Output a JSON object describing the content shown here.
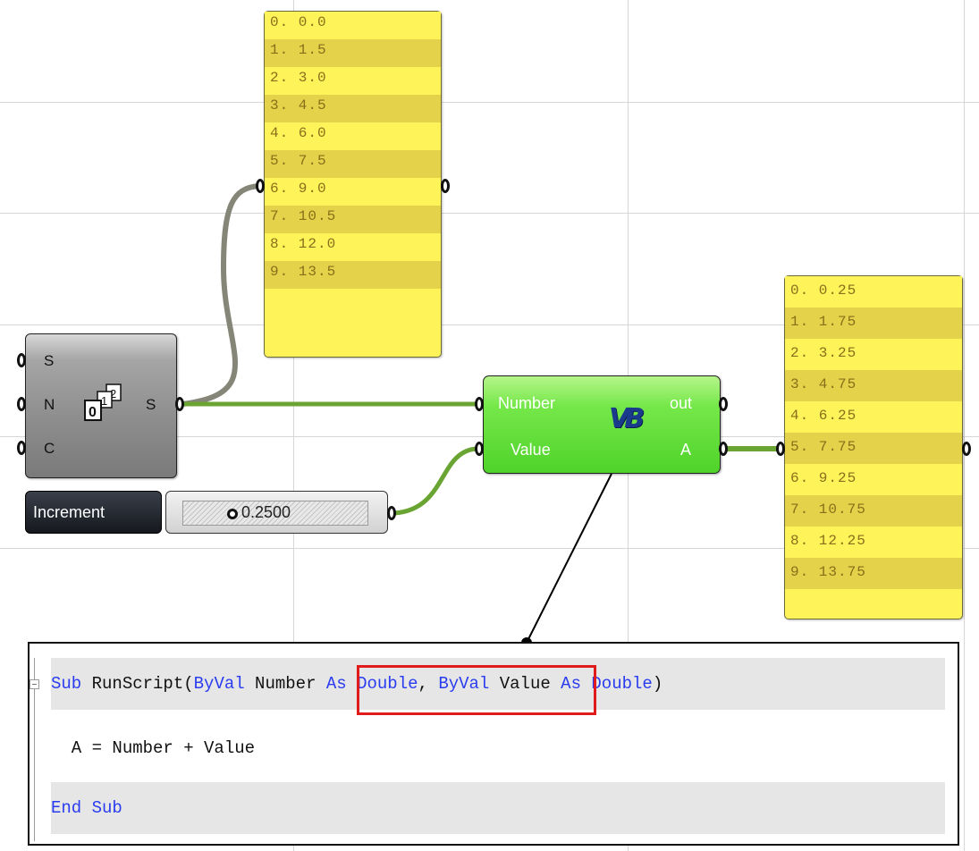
{
  "series_component": {
    "inputs": [
      "S",
      "N",
      "C"
    ],
    "output": "S",
    "icon": "series-icon"
  },
  "vb_component": {
    "inputs": [
      "Number",
      "Value"
    ],
    "outputs": [
      "out",
      "A"
    ],
    "icon": "vb-script-icon",
    "icon_text": "VB"
  },
  "slider": {
    "name": "Increment",
    "value": "0.2500"
  },
  "panel_series": [
    "0. 0.0",
    "1. 1.5",
    "2. 3.0",
    "3. 4.5",
    "4. 6.0",
    "5. 7.5",
    "6. 9.0",
    "7. 10.5",
    "8. 12.0",
    "9. 13.5"
  ],
  "panel_result": [
    "0. 0.25",
    "1. 1.75",
    "2. 3.25",
    "3. 4.75",
    "4. 6.25",
    "5. 7.75",
    "6. 9.25",
    "7. 10.75",
    "8. 12.25",
    "9. 13.75"
  ],
  "code": {
    "line1": {
      "kw_sub": "Sub",
      "name": " RunScript(",
      "kw_byval1": "ByVal",
      "param1": " Number ",
      "kw_as1": "As",
      "sp1": " ",
      "kw_double1": "Double",
      "comma": ", ",
      "kw_byval2": "ByVal",
      "param2": " Value ",
      "kw_as2": "As",
      "sp2": " ",
      "kw_double2": "Double",
      "close": ")"
    },
    "line2": "  A = Number + Value",
    "line3": {
      "kw_end": "End",
      "sp": " ",
      "kw_sub": "Sub"
    }
  },
  "colors": {
    "wire_gray": "#858578",
    "wire_green": "#6aa534",
    "panel_yellow": "#fff35a",
    "component_green": "#4fd32a",
    "keyword_blue": "#2a3cf0",
    "highlight_red": "#e11b1b"
  }
}
